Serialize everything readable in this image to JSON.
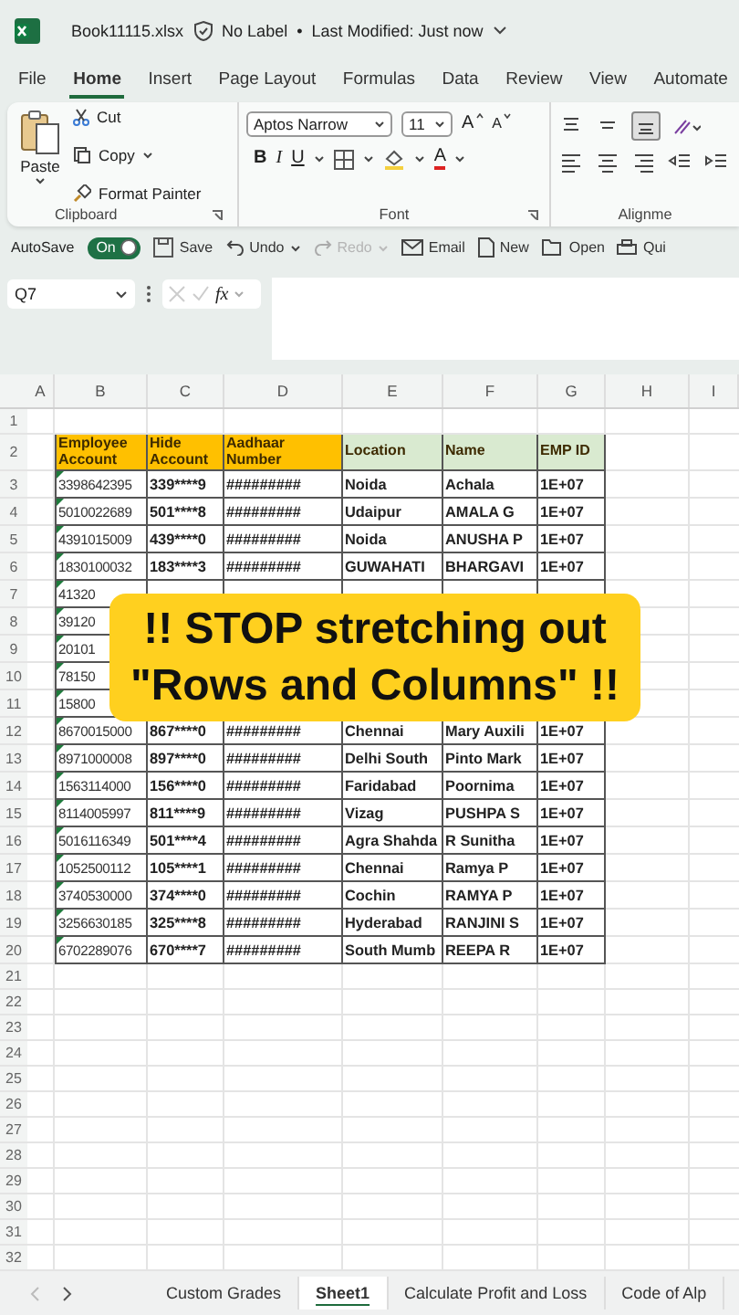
{
  "title_bar": {
    "file_name": "Book11115.xlsx",
    "label": "No Label",
    "separator": "•",
    "status": "Last Modified: Just now"
  },
  "menu_tabs": [
    {
      "label": "File",
      "selected": false
    },
    {
      "label": "Home",
      "selected": true
    },
    {
      "label": "Insert",
      "selected": false
    },
    {
      "label": "Page Layout",
      "selected": false
    },
    {
      "label": "Formulas",
      "selected": false
    },
    {
      "label": "Data",
      "selected": false
    },
    {
      "label": "Review",
      "selected": false
    },
    {
      "label": "View",
      "selected": false
    },
    {
      "label": "Automate",
      "selected": false
    }
  ],
  "ribbon": {
    "clipboard": {
      "paste": "Paste",
      "cut": "Cut",
      "copy": "Copy",
      "format_painter": "Format Painter",
      "group_label": "Clipboard"
    },
    "font": {
      "font_name": "Aptos Narrow",
      "font_size": "11",
      "grow": "A",
      "shrink": "A",
      "bold": "B",
      "italic": "I",
      "underline": "U",
      "font_color": "A",
      "group_label": "Font"
    },
    "alignment": {
      "group_label": "Alignme"
    }
  },
  "quick_access": {
    "autosave": "AutoSave",
    "toggle_label": "On",
    "on": true,
    "buttons": [
      {
        "kind": "save",
        "label": "Save",
        "disabled": false
      },
      {
        "kind": "undo",
        "label": "Undo",
        "disabled": false
      },
      {
        "kind": "redo",
        "label": "Redo",
        "disabled": true
      },
      {
        "kind": "email",
        "label": "Email",
        "disabled": false
      },
      {
        "kind": "new",
        "label": "New",
        "disabled": false
      },
      {
        "kind": "open",
        "label": "Open",
        "disabled": false
      },
      {
        "kind": "quick",
        "label": "Qui",
        "disabled": false
      }
    ]
  },
  "formula_bar": {
    "name_box": "Q7",
    "function_label": "fx"
  },
  "columns": [
    "A",
    "B",
    "C",
    "D",
    "E",
    "F",
    "G",
    "H",
    "I"
  ],
  "rows": [
    {
      "number": "1",
      "kind": "empty"
    },
    {
      "number": "2",
      "kind": "header",
      "cells": [
        {
          "text": "Employee Account",
          "color": "#ffc000"
        },
        {
          "text": "Hide Account",
          "color": "#ffc000"
        },
        {
          "text": "Aadhaar Number",
          "color": "#ffc000"
        },
        {
          "text": "Location",
          "color": "#d9ead0"
        },
        {
          "text": "Name",
          "color": "#d9ead0"
        },
        {
          "text": "EMP ID",
          "color": "#d9ead0"
        }
      ]
    },
    {
      "number": "3",
      "kind": "data",
      "cells": [
        "3398642395",
        "339****9",
        "#########",
        "Noida",
        "Achala",
        "1E+07"
      ]
    },
    {
      "number": "4",
      "kind": "data",
      "cells": [
        "5010022689",
        "501****8",
        "#########",
        "Udaipur",
        "AMALA G",
        "1E+07"
      ]
    },
    {
      "number": "5",
      "kind": "data",
      "cells": [
        "4391015009",
        "439****0",
        "#########",
        "Noida",
        "ANUSHA P",
        "1E+07"
      ]
    },
    {
      "number": "6",
      "kind": "data",
      "cells": [
        "1830100032",
        "183****3",
        "#########",
        "GUWAHATI",
        "BHARGAVI",
        "1E+07"
      ]
    },
    {
      "number": "7",
      "kind": "data",
      "cells": [
        "41320"
      ]
    },
    {
      "number": "8",
      "kind": "data",
      "cells": [
        "39120"
      ]
    },
    {
      "number": "9",
      "kind": "data",
      "cells": [
        "20101"
      ]
    },
    {
      "number": "10",
      "kind": "data",
      "cells": [
        "78150"
      ]
    },
    {
      "number": "11",
      "kind": "data",
      "cells": [
        "15800"
      ]
    },
    {
      "number": "12",
      "kind": "data",
      "cells": [
        "8670015000",
        "867****0",
        "#########",
        "Chennai",
        "Mary Auxili",
        "1E+07"
      ]
    },
    {
      "number": "13",
      "kind": "data",
      "cells": [
        "8971000008",
        "897****0",
        "#########",
        "Delhi South",
        "Pinto Mark",
        "1E+07"
      ]
    },
    {
      "number": "14",
      "kind": "data",
      "cells": [
        "1563114000",
        "156****0",
        "#########",
        "Faridabad",
        "Poornima",
        "1E+07"
      ]
    },
    {
      "number": "15",
      "kind": "data",
      "cells": [
        "8114005997",
        "811****9",
        "#########",
        "Vizag",
        "PUSHPA S",
        "1E+07"
      ]
    },
    {
      "number": "16",
      "kind": "data",
      "cells": [
        "5016116349",
        "501****4",
        "#########",
        "Agra Shahda",
        "R Sunitha",
        "1E+07"
      ]
    },
    {
      "number": "17",
      "kind": "data",
      "cells": [
        "1052500112",
        "105****1",
        "#########",
        "Chennai",
        "Ramya P",
        "1E+07"
      ]
    },
    {
      "number": "18",
      "kind": "data",
      "cells": [
        "3740530000",
        "374****0",
        "#########",
        "Cochin",
        "RAMYA P",
        "1E+07"
      ]
    },
    {
      "number": "19",
      "kind": "data",
      "cells": [
        "3256630185",
        "325****8",
        "#########",
        "Hyderabad",
        "RANJINI S",
        "1E+07"
      ]
    },
    {
      "number": "20",
      "kind": "data",
      "cells": [
        "6702289076",
        "670****7",
        "#########",
        "South Mumb",
        "REEPA R",
        "1E+07"
      ]
    },
    {
      "number": "21",
      "kind": "empty"
    },
    {
      "number": "22",
      "kind": "empty"
    },
    {
      "number": "23",
      "kind": "empty"
    },
    {
      "number": "24",
      "kind": "empty"
    },
    {
      "number": "25",
      "kind": "empty"
    },
    {
      "number": "26",
      "kind": "empty"
    },
    {
      "number": "27",
      "kind": "empty"
    },
    {
      "number": "28",
      "kind": "empty"
    },
    {
      "number": "29",
      "kind": "empty"
    },
    {
      "number": "30",
      "kind": "empty"
    },
    {
      "number": "31",
      "kind": "empty"
    },
    {
      "number": "32",
      "kind": "empty"
    }
  ],
  "caption": {
    "lines": [
      "!! STOP stretching out",
      "\"Rows and Columns\" !!"
    ]
  },
  "sheet_tabs": [
    {
      "label": "Custom Grades",
      "selected": false
    },
    {
      "label": "Sheet1",
      "selected": true
    },
    {
      "label": "Calculate Profit and Loss",
      "selected": false
    },
    {
      "label": "Code of Alp",
      "selected": false
    }
  ]
}
